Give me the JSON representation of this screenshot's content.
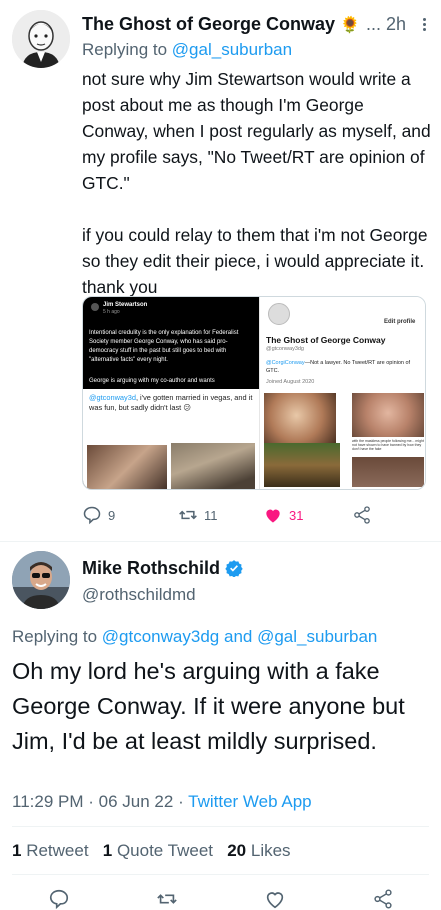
{
  "tweet1": {
    "display_name": "The Ghost of George Conway",
    "name_emoji": "🌻",
    "time": "2h",
    "replying_prefix": "Replying to",
    "replying_handle": "@gal_suburban",
    "body": "not sure why Jim Stewartson would write a post about me as though I'm George Conway, when I post regularly as myself, and my profile says, \"No Tweet/RT are opinion of GTC.\"\n\nif you could relay to them that i'm not George so they edit their piece, i would appreciate it. thank you",
    "media_left": {
      "author": "Jim Stewartson",
      "time": "5 h ago",
      "text1": "Intentional credulity is the only explanation for Federalist Society member George Conway, who has said pro-democracy stuff in the past but still goes to bed with \"alternative facts\" every night.",
      "text2": "George is arguing with my co-author and wants",
      "reply_handle": "@gtconway3d",
      "reply_text": ", i've gotten married in vegas, and it was fun, but sadly didn't last 😕"
    },
    "media_right": {
      "edit_profile": "Edit profile",
      "name": "The Ghost of George Conway",
      "handle": "@gtconway3dg",
      "bio_handle": "@CorgiConway",
      "bio": "—Not a lawyer. No Tweet/RT are opinion of GTC.",
      "joined": "Joined August 2020",
      "caption": "with the maskless people following me... might not have shown to have banned by how they don't have the fake"
    },
    "replies": "9",
    "retweets": "11",
    "likes": "31"
  },
  "tweet2": {
    "display_name": "Mike Rothschild",
    "handle": "@rothschildmd",
    "replying_prefix": "Replying to",
    "replying_handle1": "@gtconway3dg",
    "replying_and": "and",
    "replying_handle2": "@gal_suburban",
    "body": "Oh my lord he's arguing with a fake George Conway. If it were anyone but Jim, I'd be at least mildly surprised.",
    "time": "11:29 PM",
    "date": "06 Jun 22",
    "source": "Twitter Web App",
    "retweet_count": "1",
    "retweet_label": "Retweet",
    "quote_count": "1",
    "quote_label": "Quote Tweet",
    "like_count": "20",
    "like_label": "Likes"
  },
  "colors": {
    "accent": "#1d9bf0",
    "like": "#f91880",
    "verified": "#1d9bf0",
    "muted": "#536471"
  }
}
